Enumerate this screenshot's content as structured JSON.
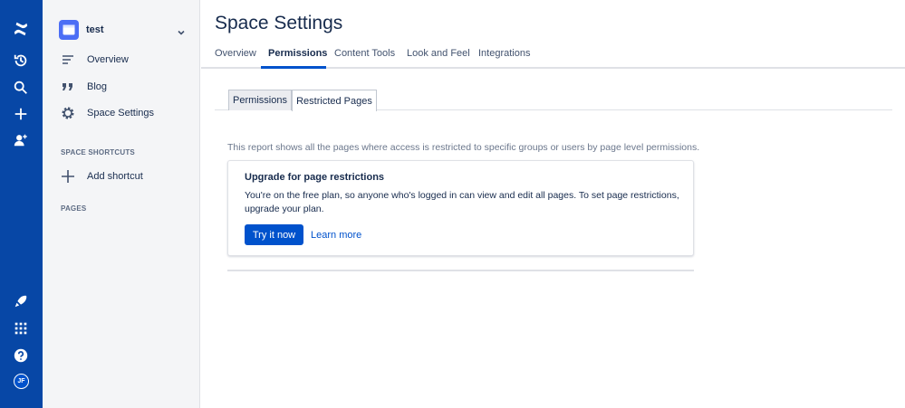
{
  "sidebar": {
    "space_name": "test",
    "items": [
      {
        "label": "Overview",
        "icon": "overview-lines-icon"
      },
      {
        "label": "Blog",
        "icon": "quote-icon"
      },
      {
        "label": "Space Settings",
        "icon": "gear-icon"
      }
    ],
    "shortcuts_heading": "SPACE SHORTCUTS",
    "add_shortcut": "Add shortcut",
    "pages_heading": "PAGES"
  },
  "global_nav": {
    "avatar_initials": "JF",
    "icons": [
      "confluence-logo-icon",
      "recent-icon",
      "search-icon",
      "create-icon",
      "people-icon",
      "rocket-icon",
      "app-switcher-icon",
      "help-icon"
    ]
  },
  "header": {
    "title": "Space Settings",
    "tabs": [
      {
        "label": "Overview"
      },
      {
        "label": "Permissions"
      },
      {
        "label": "Content Tools"
      },
      {
        "label": "Look and Feel"
      },
      {
        "label": "Integrations"
      }
    ],
    "active_tab": "Permissions"
  },
  "subtabs": [
    {
      "label": "Permissions"
    },
    {
      "label": "Restricted Pages"
    }
  ],
  "active_subtab": "Restricted Pages",
  "report": {
    "description": "This report shows all the pages where access is restricted to specific groups or users by page level permissions."
  },
  "upgrade_card": {
    "title": "Upgrade for page restrictions",
    "body": "You're on the free plan, so anyone who's logged in can view and edit all pages. To set page restrictions, upgrade your plan.",
    "primary_button": "Try it now",
    "link": "Learn more"
  },
  "colors": {
    "rail": "#0747a6",
    "accent": "#0052cc",
    "space_logo": "#4c6ef5"
  }
}
